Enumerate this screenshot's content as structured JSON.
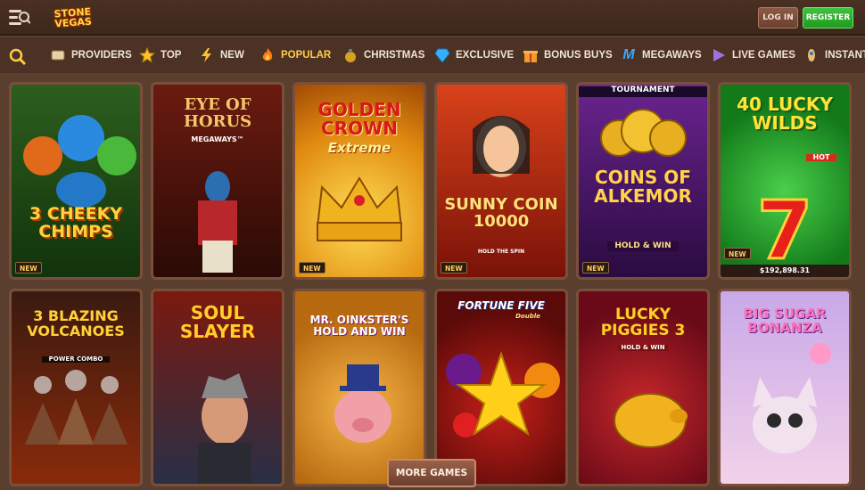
{
  "header": {
    "logo_line1": "STONE",
    "logo_line2": "VEGAS",
    "login_label": "LOG IN",
    "register_label": "REGISTER"
  },
  "categories": [
    {
      "label": "PROVIDERS",
      "icon": "scroll-icon"
    },
    {
      "label": "TOP",
      "icon": "star-icon"
    },
    {
      "label": "NEW",
      "icon": "lightning-icon"
    },
    {
      "label": "POPULAR",
      "icon": "fire-icon",
      "active": true
    },
    {
      "label": "CHRISTMAS",
      "icon": "ornament-icon"
    },
    {
      "label": "EXCLUSIVE",
      "icon": "diamond-icon"
    },
    {
      "label": "BONUS BUYS",
      "icon": "gift-icon"
    },
    {
      "label": "MEGAWAYS",
      "icon": "megaways-icon"
    },
    {
      "label": "LIVE GAMES",
      "icon": "play-icon"
    },
    {
      "label": "INSTANT G",
      "icon": "rocket-icon"
    }
  ],
  "games": [
    {
      "title": "3 CHEEKY CHIMPS",
      "badge": "NEW"
    },
    {
      "title": "EYE OF HORUS",
      "subtitle": "MEGAWAYS™"
    },
    {
      "title": "GOLDEN CROWN",
      "subtitle": "Extreme",
      "badge": "NEW"
    },
    {
      "title": "SUNNY COIN 10000",
      "subtitle": "HOLD THE SPIN",
      "badge": "NEW"
    },
    {
      "title": "COINS OF ALKEMOR",
      "subtitle": "HOLD & WIN",
      "top_label": "TOURNAMENT",
      "badge": "NEW"
    },
    {
      "title": "40 LUCKY WILDS",
      "subtitle": "HOT",
      "badge": "NEW",
      "jackpot": "$192,898.31"
    },
    {
      "title": "3 BLAZING VOLCANOES",
      "subtitle": "POWER COMBO"
    },
    {
      "title": "SOUL SLAYER"
    },
    {
      "title": "MR. OINKSTER'S HOLD AND WIN"
    },
    {
      "title": "FORTUNE FIVE",
      "subtitle": "Double"
    },
    {
      "title": "LUCKY PIGGIES 3",
      "subtitle": "HOLD & WIN"
    },
    {
      "title": "BIG SUGAR BONANZA"
    }
  ],
  "more_label": "MORE GAMES",
  "colors": {
    "background": "#5a3e2e",
    "accent_active": "#ffcb4a",
    "register_green": "#2fb52f"
  }
}
